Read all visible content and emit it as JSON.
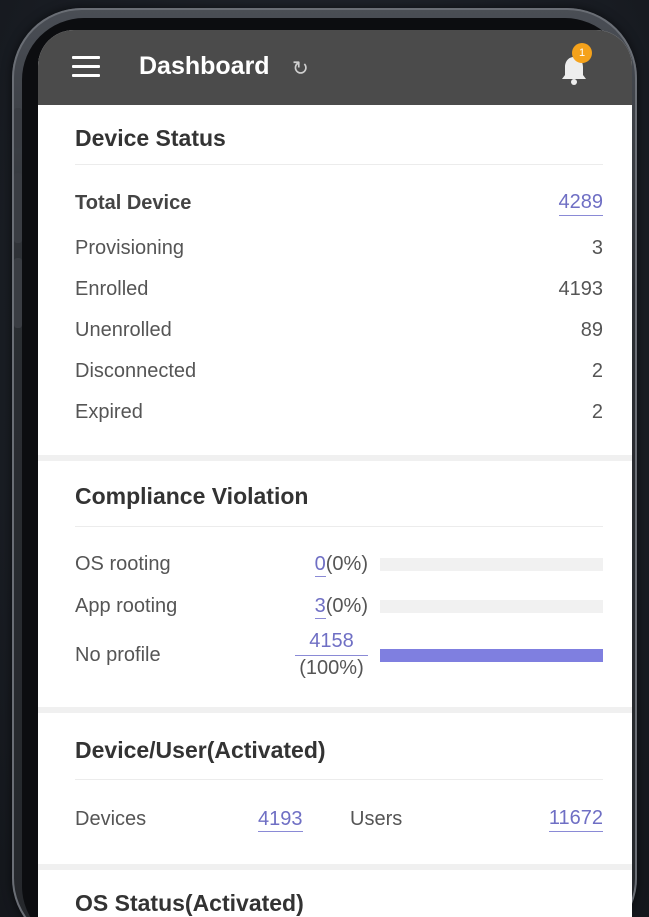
{
  "header": {
    "title": "Dashboard",
    "notification_count": "1"
  },
  "device_status": {
    "title": "Device Status",
    "total_label": "Total Device",
    "total_value": "4289",
    "rows": [
      {
        "label": "Provisioning",
        "value": "3"
      },
      {
        "label": "Enrolled",
        "value": "4193"
      },
      {
        "label": "Unenrolled",
        "value": "89"
      },
      {
        "label": "Disconnected",
        "value": "2"
      },
      {
        "label": "Expired",
        "value": "2"
      }
    ]
  },
  "compliance": {
    "title": "Compliance Violation",
    "rows": [
      {
        "label": "OS rooting",
        "count": "0",
        "percent": "(0%)",
        "fraction": 0
      },
      {
        "label": "App rooting",
        "count": "3",
        "percent": "(0%)",
        "fraction": 0
      },
      {
        "label": "No profile",
        "count": "4158",
        "percent": "(100%)",
        "fraction": 1
      }
    ]
  },
  "activated": {
    "title": "Device/User(Activated)",
    "devices_label": "Devices",
    "devices_value": "4193",
    "users_label": "Users",
    "users_value": "11672"
  },
  "os_status": {
    "title": "OS Status(Activated)"
  },
  "colors": {
    "accent": "#7f7fe0",
    "header_bg": "#4b4b4b",
    "badge": "#f5a21b"
  }
}
